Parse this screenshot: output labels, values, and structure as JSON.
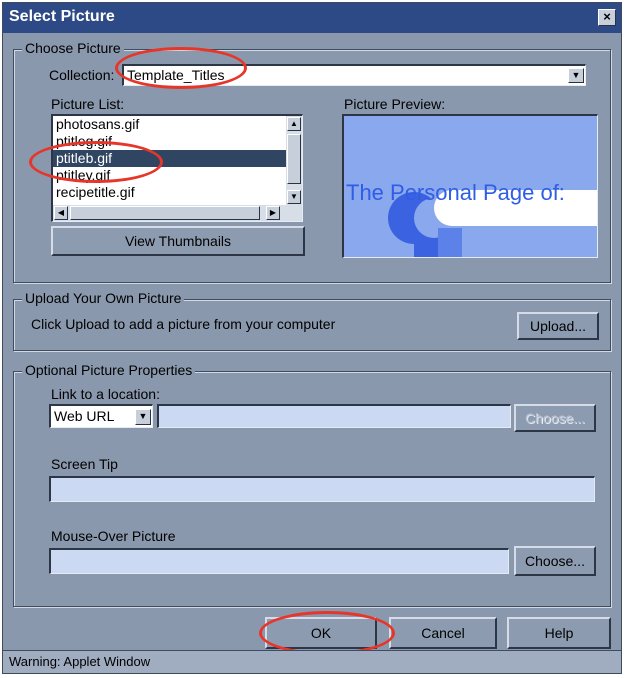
{
  "window": {
    "title": "Select Picture",
    "close_glyph": "×"
  },
  "choose_picture": {
    "legend": "Choose Picture",
    "collection_label": "Collection:",
    "collection_value": "Template_Titles",
    "picture_list_label": "Picture List:",
    "picture_list": [
      "photosans.gif",
      "ptitleg.gif",
      "ptitleb.gif",
      "ptitley.gif",
      "recipetitle.gif"
    ],
    "selected_picture": "ptitleb.gif",
    "view_thumbnails_label": "View Thumbnails",
    "preview_label": "Picture Preview:",
    "preview_text": "The Personal Page of:"
  },
  "upload": {
    "legend": "Upload Your Own Picture",
    "description": "Click Upload to add a picture from your computer",
    "upload_label": "Upload..."
  },
  "optional": {
    "legend": "Optional Picture Properties",
    "link_label": "Link to a location:",
    "link_type": "Web URL",
    "link_value": "",
    "choose_disabled_label": "Choose...",
    "screen_tip_label": "Screen Tip",
    "screen_tip_value": "",
    "mouseover_label": "Mouse-Over Picture",
    "mouseover_value": "",
    "choose_label": "Choose..."
  },
  "buttons": {
    "ok": "OK",
    "cancel": "Cancel",
    "help": "Help"
  },
  "status": "Warning: Applet Window",
  "icons": [
    "close-icon",
    "dropdown-arrow-icon",
    "scroll-up-icon",
    "scroll-down-icon",
    "scroll-left-icon",
    "scroll-right-icon"
  ],
  "colors": {
    "title_bar": "#2e4a86",
    "dialog_bg": "#8a98ad",
    "selection": "#2f4561",
    "field_bg": "#cbdaf2",
    "preview_bg": "#8aa8ee",
    "highlight_circle": "#e6362a"
  }
}
